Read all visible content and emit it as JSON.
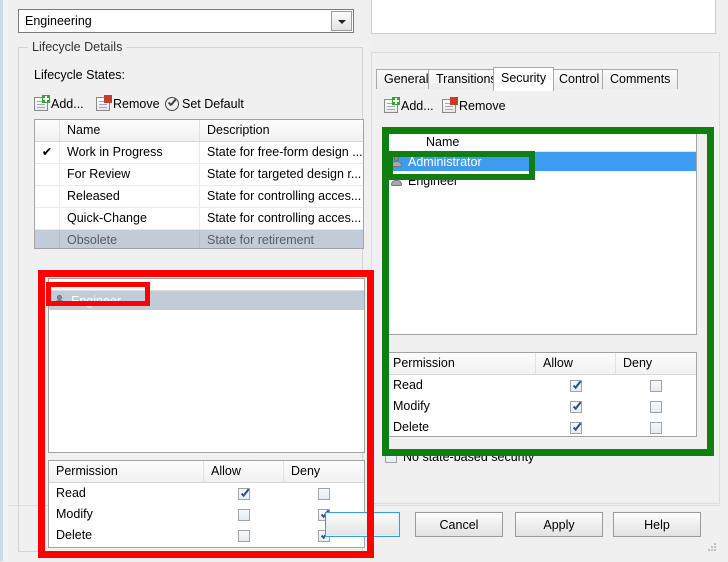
{
  "category": {
    "value": "Engineering",
    "dropdown_icon": "chevron-down-icon"
  },
  "lifecycle_group": {
    "title": "Lifecycle Details",
    "states_label": "Lifecycle States:",
    "toolbar": {
      "add": "Add...",
      "remove": "Remove",
      "set_default": "Set Default"
    },
    "states_table": {
      "columns": [
        "",
        "Name",
        "Description"
      ],
      "rows": [
        {
          "default": "✔",
          "name": "Work in Progress",
          "description": "State for free-form design ...",
          "selected": false
        },
        {
          "default": "",
          "name": "For Review",
          "description": "State for targeted design r...",
          "selected": false
        },
        {
          "default": "",
          "name": "Released",
          "description": "State for controlling acces...",
          "selected": false
        },
        {
          "default": "",
          "name": "Quick-Change",
          "description": "State for controlling acces...",
          "selected": false
        },
        {
          "default": "",
          "name": "Obsolete",
          "description": "State for retirement",
          "selected": true
        }
      ]
    }
  },
  "left_member_list": {
    "items": [
      {
        "name": "Engineer",
        "icon": "user-icon",
        "selected": true
      }
    ]
  },
  "left_permissions": {
    "columns": [
      "Permission",
      "Allow",
      "Deny"
    ],
    "rows": [
      {
        "permission": "Read",
        "allow": true,
        "deny": false
      },
      {
        "permission": "Modify",
        "allow": false,
        "deny": true
      },
      {
        "permission": "Delete",
        "allow": false,
        "deny": true
      }
    ]
  },
  "right_panel": {
    "tabs": [
      {
        "label": "General",
        "active": false
      },
      {
        "label": "Transitions",
        "active": false
      },
      {
        "label": "Security",
        "active": true
      },
      {
        "label": "Control",
        "active": false
      },
      {
        "label": "Comments",
        "active": false
      }
    ],
    "toolbar": {
      "add": "Add...",
      "remove": "Remove"
    },
    "member_list": {
      "header": "Name",
      "items": [
        {
          "name": "Administrator",
          "icon": "user-icon",
          "selected": true
        },
        {
          "name": "Engineer",
          "icon": "user-icon",
          "selected": false
        }
      ]
    },
    "permissions": {
      "columns": [
        "Permission",
        "Allow",
        "Deny"
      ],
      "rows": [
        {
          "permission": "Read",
          "allow": true,
          "deny": false
        },
        {
          "permission": "Modify",
          "allow": true,
          "deny": false
        },
        {
          "permission": "Delete",
          "allow": true,
          "deny": false
        }
      ]
    },
    "no_state_security": {
      "label": "No state-based security",
      "checked": false
    }
  },
  "dialog_buttons": {
    "ok": "",
    "cancel": "Cancel",
    "apply": "Apply",
    "help": "Help"
  },
  "annotations": {
    "red_color": "#fe0000",
    "green_color": "#0e7f10"
  },
  "colors": {
    "selection_blue": "#3d9bf0",
    "selection_inactive": "#c2ccd9",
    "dialog_bg": "#f0f0f0"
  }
}
